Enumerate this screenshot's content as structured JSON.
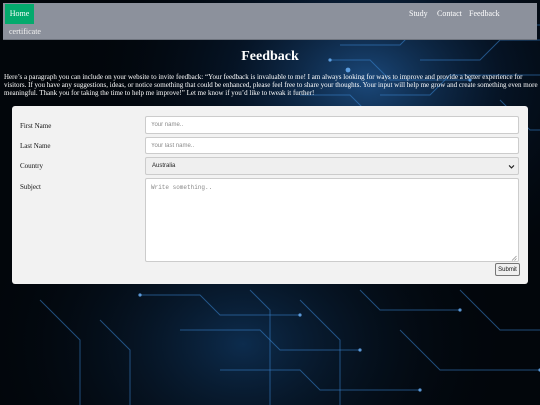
{
  "nav": {
    "home_label": "Home",
    "items": [
      "Study",
      "Contact",
      "Feedback"
    ],
    "cert_label": "certificate"
  },
  "page": {
    "title": "Feedback",
    "intro": "Here’s a paragraph you can include on your website to invite feedback: “Your feedback is invaluable to me! I am always looking for ways to improve and provide a better experience for visitors. If you have any suggestions, ideas, or notice something that could be enhanced, please feel free to share your thoughts. Your input will help me grow and create something even more meaningful. Thank you for taking the time to help me improve!” Let me know if you’d like to tweak it further!"
  },
  "form": {
    "first_name": {
      "label": "First Name",
      "placeholder": "Your name..",
      "value": ""
    },
    "last_name": {
      "label": "Last Name",
      "placeholder": "Your last name..",
      "value": ""
    },
    "country": {
      "label": "Country",
      "selected": "Australia"
    },
    "subject": {
      "label": "Subject",
      "placeholder": "Write something..",
      "value": ""
    },
    "submit_label": "Submit"
  },
  "colors": {
    "nav_bg": "#8c919c",
    "home_active": "#04aa6d",
    "page_bg": "#02060b",
    "circuit_glow": "#1e90ff",
    "form_bg": "#f2f2f2"
  },
  "icons": {
    "select_arrow": "chevron-down-icon",
    "textarea_resize": "resize-grip-icon"
  }
}
